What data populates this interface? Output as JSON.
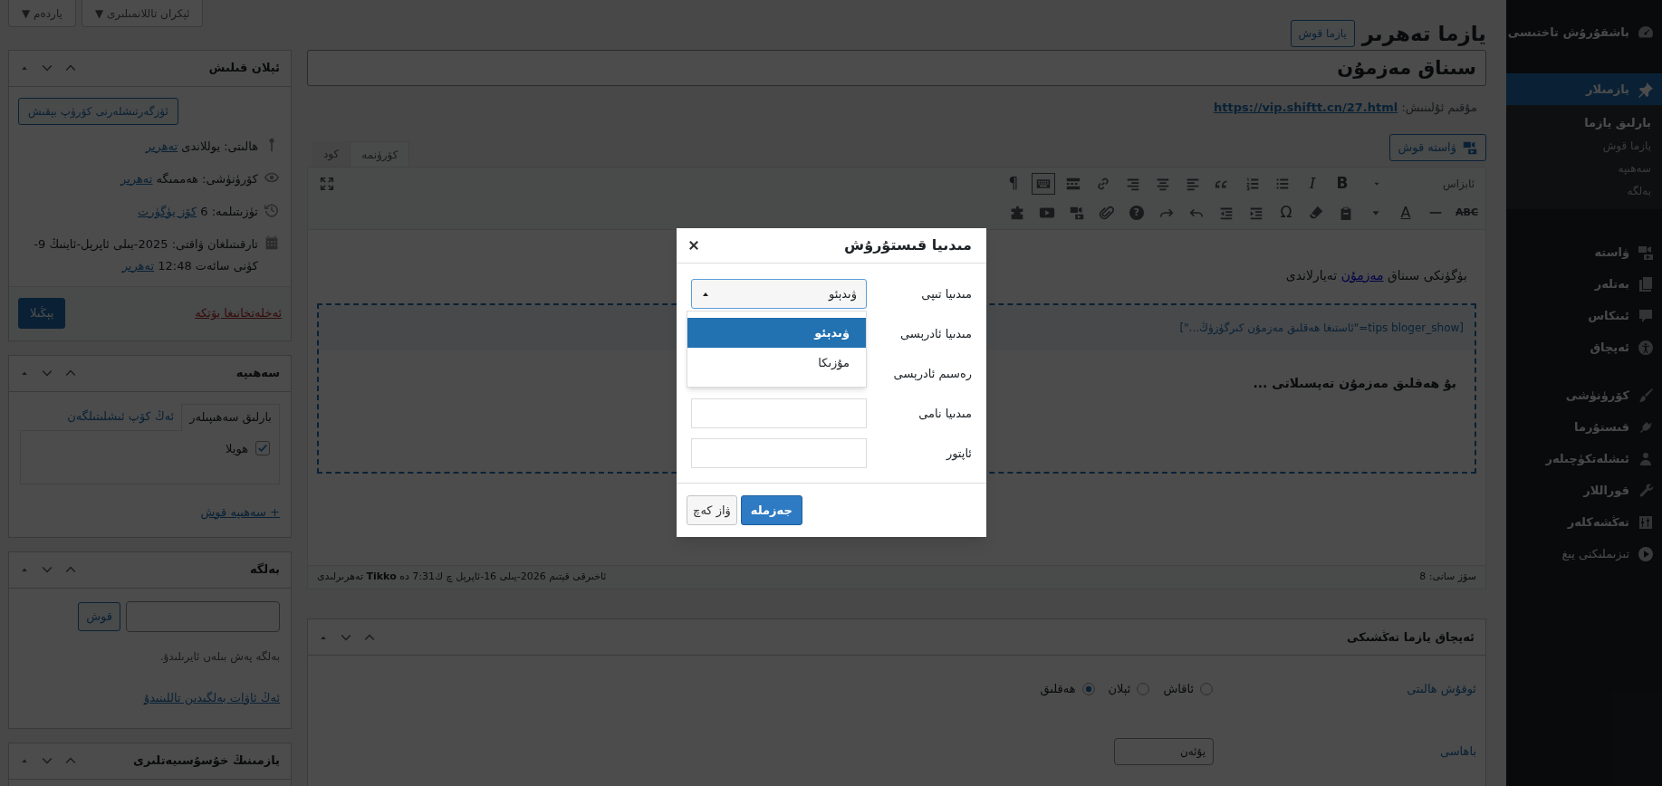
{
  "admin_menu": {
    "items": [
      {
        "label": "باشقۇرۇش تاختىسى",
        "selected": false
      },
      {
        "label": "يازمىلار",
        "selected": true,
        "children": [
          {
            "label": "بارلىق يازما",
            "selected": true
          },
          {
            "label": "يازما قوش",
            "selected": false
          },
          {
            "label": "سەھىپە",
            "selected": false
          },
          {
            "label": "بەلگە",
            "selected": false
          }
        ]
      },
      {
        "label": "ۋاستە",
        "selected": false
      },
      {
        "label": "بەتلەر",
        "selected": false
      },
      {
        "label": "ئىنكاس",
        "selected": false
      },
      {
        "label": "ئەپچاق",
        "selected": false
      },
      {
        "label": "كۆرۈنۈشى",
        "selected": false
      },
      {
        "label": "قىستۇرما",
        "selected": false
      },
      {
        "label": "ئىشلەتكۈچىلەر",
        "selected": false
      },
      {
        "label": "قوراللار",
        "selected": false
      },
      {
        "label": "تەڭشەكلەر",
        "selected": false
      }
    ],
    "collapse_label": "تىزىملىكنى يىغ"
  },
  "screen_tabs": [
    {
      "label": "ئېكران تاللانمىلىرى ▼"
    },
    {
      "label": "ياردەم ▼"
    }
  ],
  "page_title": "يازما تەھرىر",
  "add_new_button": "يازما قوش",
  "post_title": "سىناق مەزمۇن",
  "permalink": {
    "label": "مۇقىم ئۇلىنىش:",
    "url": "https://vip.shiftt.cn/27.html"
  },
  "add_media_button": "ۋاستە قوش",
  "editor_tabs": [
    {
      "label": "كۆرۈنمە",
      "selected": true
    },
    {
      "label": "كود",
      "selected": false
    }
  ],
  "toolbar": {
    "row_1": [
      {
        "kind": "select",
        "text": "ئابزاس",
        "pressed": false
      },
      {
        "kind": "glyph",
        "text": "B",
        "pressed": false
      },
      {
        "kind": "glyph",
        "text": "I",
        "pressed": false
      },
      {
        "kind": "icon",
        "pressed": false
      },
      {
        "kind": "icon",
        "pressed": false
      },
      {
        "kind": "icon",
        "pressed": false
      },
      {
        "kind": "icon",
        "pressed": false
      },
      {
        "kind": "icon",
        "pressed": false
      },
      {
        "kind": "icon",
        "pressed": false
      },
      {
        "kind": "icon",
        "pressed": false
      },
      {
        "kind": "icon",
        "pressed": false
      },
      {
        "kind": "icon",
        "pressed": true
      },
      {
        "kind": "glyph",
        "text": "¶",
        "pressed": false
      }
    ],
    "row_2": [
      {
        "kind": "glyph",
        "text": "ABC"
      },
      {
        "kind": "icon"
      },
      {
        "kind": "glyph",
        "text": "A"
      },
      {
        "kind": "icon"
      },
      {
        "kind": "icon"
      },
      {
        "kind": "icon"
      },
      {
        "kind": "glyph",
        "text": "Ω"
      },
      {
        "kind": "icon"
      },
      {
        "kind": "icon"
      },
      {
        "kind": "icon"
      },
      {
        "kind": "icon"
      },
      {
        "kind": "circle_glyph",
        "text": "?"
      },
      {
        "kind": "icon"
      },
      {
        "kind": "icon"
      },
      {
        "kind": "icon"
      },
      {
        "kind": "icon"
      }
    ]
  },
  "content": {
    "paragraph_before": "بۈگۈنكى سىناق",
    "paragraph_link": "مەزمۇن",
    "paragraph_after": "تەيارلاندى",
    "shortcode": "[tips bloger_show=\"ئاستىغا ھەقلىق مەزمۇن كىرگۈزۈڭ...\"]",
    "paid_text": "بۇ ھەقلىق مەزمۇن تەپسىلاتى ..."
  },
  "status_bar": {
    "word_count": "سۆز سانى: 8",
    "last_edited": "ئاخىرقى قېتىم 2026-يىلى 16-ئاپرېل چ ك7:31 دە **Tikko** تەھرىرلىدى"
  },
  "settings_box": {
    "title": "ئەپچاق يازما تەڭشىكى",
    "read_mode": {
      "label": "ئوقۇش ھالىتى",
      "options": [
        {
          "label": "ئاقاش",
          "selected": false
        },
        {
          "label": "ئېلان",
          "selected": false
        },
        {
          "label": "ھەقلىق",
          "selected": true
        }
      ]
    },
    "price": {
      "label": "باھاسى",
      "value": "يۇئەن"
    }
  },
  "publish_box": {
    "title": "ئېلان قىلىش",
    "preview_button": "ئۆزگەرتىشلەرنى كۆرۈپ بېقىش",
    "rows": [
      {
        "text": "ھالىتى: يوللاندى",
        "link": "تەھرىر"
      },
      {
        "text": "كۆرۈنۈشى: ھەممىگە",
        "link": "تەھرىر"
      },
      {
        "text": "تۈزىتىلمە: 6",
        "link": "كۆز يۈگۈرت"
      },
      {
        "text": "تارقىتىلغان ۋاقتى: 2025-يىلى ئاپرېل-ئاينىڭ 9-كۈنى سائەت 12:48",
        "link": "تەھرىر"
      }
    ],
    "trash_link": "ئەخلەتخانىغا يۆتكە",
    "update_button": "يېڭىلا"
  },
  "category_box": {
    "title": "سەھىپە",
    "tabs": [
      {
        "label": "بارلىق سەھىپىلەر",
        "selected": true
      },
      {
        "label": "ئەڭ كۆپ ئىشلىتىلگەن",
        "selected": false
      }
    ],
    "categories": [
      {
        "label": "ھويلا",
        "checked": true
      }
    ],
    "add_link": "+ سەھىپە قوش"
  },
  "tags_box": {
    "title": "بەلگە",
    "add_button": "قوش",
    "note": "بەلگە پەش بىلەن ئايرىلىدۇ.",
    "popular_link": "ئەڭ ئاۋات بەلگىدىن تاللىنىدۇ"
  },
  "attributes_box": {
    "title": "يازمىنىڭ خۇسۇسىيەتلىرى"
  },
  "dialog": {
    "title": "مىدىيا قىستۇرۇش",
    "fields": [
      {
        "kind": "select",
        "label": "مىدىيا تىپى",
        "value": "ۋىدېئو",
        "expanded": true,
        "options": [
          {
            "label": "ۋىدېئو",
            "selected": true
          },
          {
            "label": "مۇزىكا",
            "selected": false
          }
        ]
      },
      {
        "kind": "covered",
        "label": "مىدىيا ئادرېسى"
      },
      {
        "kind": "covered",
        "label": "رەسىم ئادرېسى"
      },
      {
        "kind": "input",
        "label": "مىدىيا نامى"
      },
      {
        "kind": "input",
        "label": "ئاپتور"
      }
    ],
    "ok_button": "جەزملە",
    "cancel_button": "ۋاز كەچ"
  }
}
